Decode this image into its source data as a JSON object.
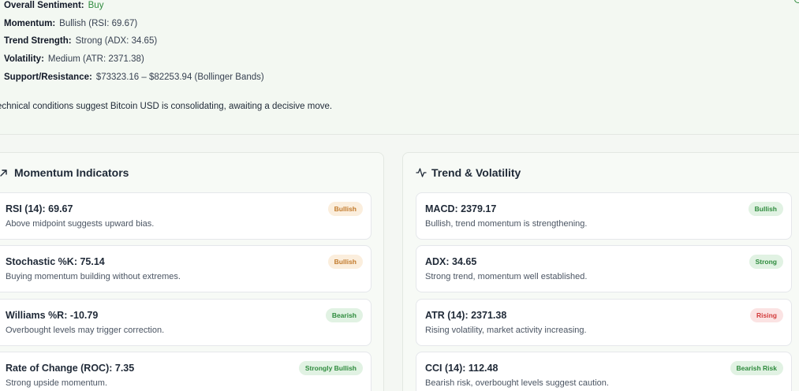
{
  "summary": {
    "lines": [
      {
        "label": "Overall Sentiment:",
        "value": "Buy"
      },
      {
        "label": "Momentum:",
        "value": "Bullish (RSI: 69.67)"
      },
      {
        "label": "Trend Strength:",
        "value": "Strong (ADX: 34.65)"
      },
      {
        "label": "Volatility:",
        "value": "Medium (ATR: 2371.38)"
      },
      {
        "label": "Support/Resistance:",
        "value": "$73323.16 – $82253.94 (Bollinger Bands)"
      }
    ],
    "conclusion": "echnical conditions suggest Bitcoin USD is consolidating, awaiting a decisive move."
  },
  "momentum": {
    "title": "Momentum Indicators",
    "icon": "trend-arrow-icon",
    "cards": [
      {
        "title": "RSI (14): 69.67",
        "desc": "Above midpoint suggests upward bias.",
        "badge": "Bullish"
      },
      {
        "title": "Stochastic %K: 75.14",
        "desc": "Buying momentum building without extremes.",
        "badge": "Bullish"
      },
      {
        "title": "Williams %R: -10.79",
        "desc": "Overbought levels may trigger correction.",
        "badge": "Bearish"
      },
      {
        "title": "Rate of Change (ROC): 7.35",
        "desc": "Strong upside momentum.",
        "badge": "Strongly Bullish"
      }
    ]
  },
  "trend": {
    "title": "Trend & Volatility",
    "icon": "activity-pulse-icon",
    "cards": [
      {
        "title": "MACD: 2379.17",
        "desc": "Bullish, trend momentum is strengthening.",
        "badge": "Bullish"
      },
      {
        "title": "ADX: 34.65",
        "desc": "Strong trend, momentum well established.",
        "badge": "Strong"
      },
      {
        "title": "ATR (14): 2371.38",
        "desc": "Rising volatility, market activity increasing.",
        "badge": "Rising"
      },
      {
        "title": "CCI (14): 112.48",
        "desc": "Bearish risk, overbought levels suggest caution.",
        "badge": "Bearish Risk"
      }
    ]
  },
  "colors": {
    "accent_green": "#2e8b3d",
    "badge_orange": "#c27a2c",
    "badge_red": "#d23b3b"
  }
}
